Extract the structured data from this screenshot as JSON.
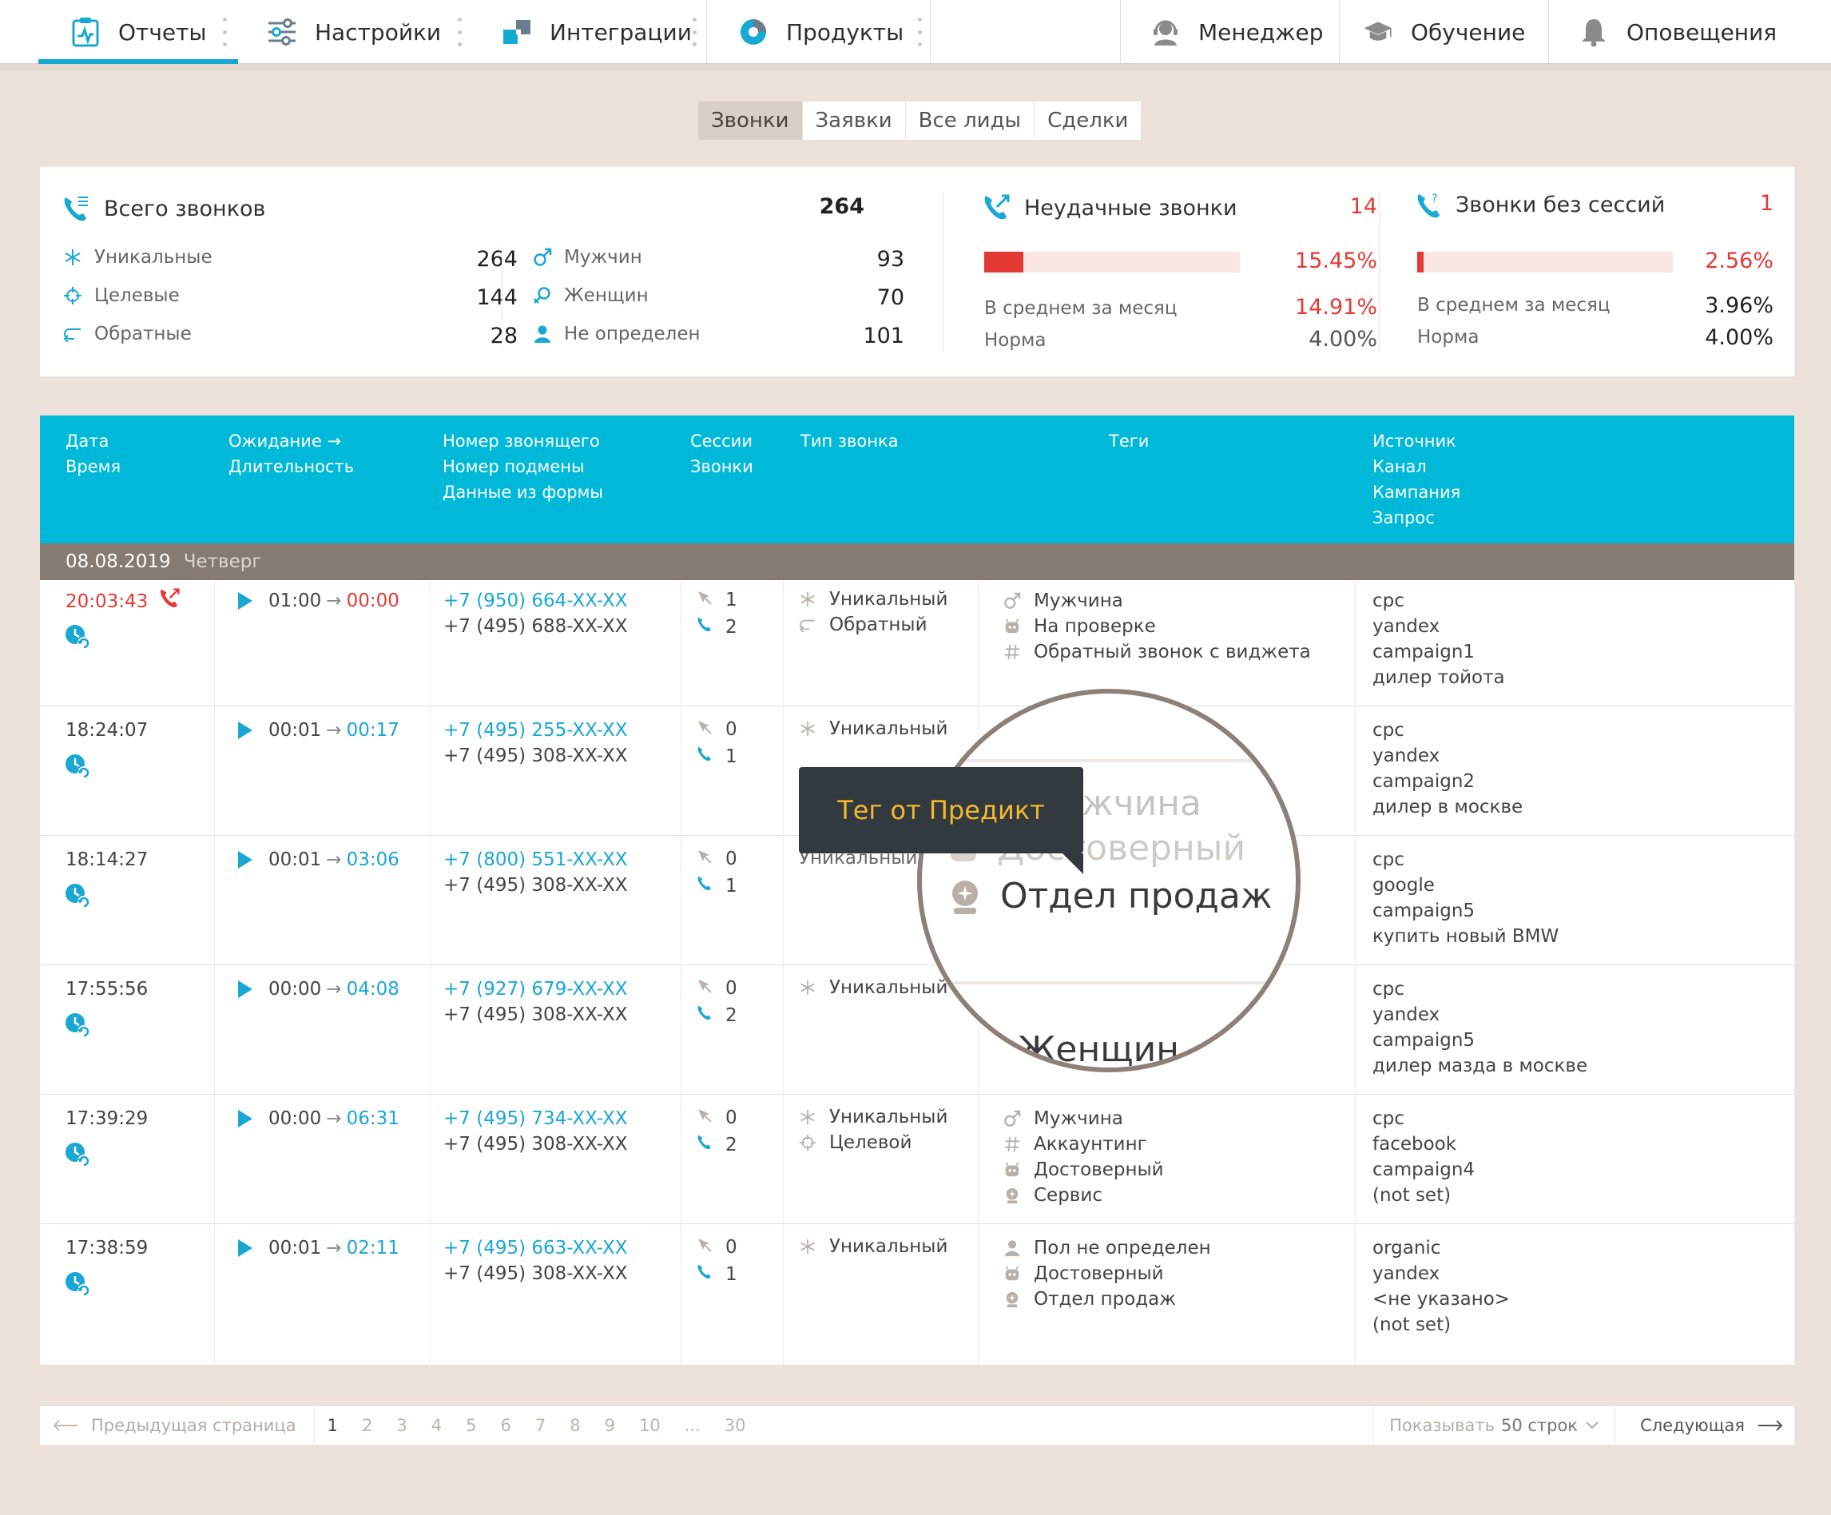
{
  "nav": {
    "items": [
      {
        "label": "Отчеты",
        "icon": "reports-icon"
      },
      {
        "label": "Настройки",
        "icon": "settings-sliders-icon"
      },
      {
        "label": "Интеграции",
        "icon": "integrations-icon"
      },
      {
        "label": "Продукты",
        "icon": "products-icon"
      }
    ],
    "right": [
      {
        "label": "Менеджер",
        "icon": "manager-headset-icon"
      },
      {
        "label": "Обучение",
        "icon": "education-cap-icon"
      },
      {
        "label": "Оповещения",
        "icon": "bell-icon"
      }
    ]
  },
  "tabs": [
    "Звонки",
    "Заявки",
    "Все лиды",
    "Сделки"
  ],
  "colors": {
    "accent": "#00b9d9",
    "link": "#1aa7d4",
    "danger": "#e53935",
    "band": "#857b73",
    "background": "#ece2db"
  },
  "stats": {
    "total": {
      "title": "Всего звонков",
      "value": "264"
    },
    "types": [
      {
        "label": "Уникальные",
        "value": "264"
      },
      {
        "label": "Целевые",
        "value": "144"
      },
      {
        "label": "Обратные",
        "value": "28"
      }
    ],
    "genders": [
      {
        "label": "Мужчин",
        "value": "93"
      },
      {
        "label": "Женщин",
        "value": "70"
      },
      {
        "label": "Не определен",
        "value": "101"
      }
    ],
    "failed": {
      "title": "Неудачные звонки",
      "value": "14",
      "percent": "15.45%",
      "progress": 0.1545,
      "avg_label": "В среднем за месяц",
      "avg": "14.91%",
      "norm_label": "Норма",
      "norm": "4.00%"
    },
    "nosession": {
      "title": "Звонки без сессий",
      "value": "1",
      "percent": "2.56%",
      "progress": 0.0256,
      "avg_label": "В среднем за месяц",
      "avg": "3.96%",
      "norm_label": "Норма",
      "norm": "4.00%"
    }
  },
  "table": {
    "headers": {
      "date": [
        "Дата",
        "Время"
      ],
      "wait": [
        "Ожидание →",
        "Длительность"
      ],
      "number": [
        "Номер звонящего",
        "Номер подмены",
        "Данные из формы"
      ],
      "sessions": [
        "Сессии",
        "Звонки"
      ],
      "type": [
        "Тип звонка"
      ],
      "tags": [
        "Теги"
      ],
      "source": [
        "Источник",
        "Канал",
        "Кампания",
        "Запрос"
      ]
    },
    "date_band": {
      "date": "08.08.2019",
      "weekday": "Четверг"
    },
    "rows": [
      {
        "time": "20:03:43",
        "failed": true,
        "wait": "01:00",
        "dur": "00:00",
        "caller": "+7 (950) 664-XX-XX",
        "sub": "+7 (495) 688-XX-XX",
        "sessions": "1",
        "calls": "2",
        "types": [
          {
            "icon": "asterisk-icon",
            "label": "Уникальный"
          },
          {
            "icon": "callback-icon",
            "label": "Обратный"
          }
        ],
        "tags": [
          {
            "icon": "male-icon",
            "label": "Мужчина"
          },
          {
            "icon": "robot-icon",
            "label": "На проверке"
          },
          {
            "icon": "hash-icon",
            "label": "Обратный звонок с виджета"
          }
        ],
        "source": [
          "cpc",
          "yandex",
          "campaign1",
          "дилер тойота"
        ]
      },
      {
        "time": "18:24:07",
        "failed": false,
        "wait": "00:01",
        "dur": "00:17",
        "caller": "+7 (495) 255-XX-XX",
        "sub": "+7 (495) 308-XX-XX",
        "sessions": "0",
        "calls": "1",
        "types": [
          {
            "icon": "asterisk-icon",
            "label": "Уникальный"
          }
        ],
        "tags": [],
        "source": [
          "cpc",
          "yandex",
          "campaign2",
          "дилер в москве"
        ]
      },
      {
        "time": "18:14:27",
        "failed": false,
        "wait": "00:01",
        "dur": "03:06",
        "caller": "+7 (800) 551-XX-XX",
        "sub": "+7 (495) 308-XX-XX",
        "sessions": "0",
        "calls": "1",
        "types": [],
        "tags": [],
        "source": [
          "cpc",
          "google",
          "campaign5",
          "купить новый BMW"
        ]
      },
      {
        "time": "17:55:56",
        "failed": false,
        "wait": "00:00",
        "dur": "04:08",
        "caller": "+7 (927) 679-XX-XX",
        "sub": "+7 (495) 308-XX-XX",
        "sessions": "0",
        "calls": "2",
        "types": [
          {
            "icon": "asterisk-icon",
            "label": "Уникальный"
          }
        ],
        "tags": [],
        "source": [
          "cpc",
          "yandex",
          "campaign5",
          "дилер мазда в москве"
        ]
      },
      {
        "time": "17:39:29",
        "failed": false,
        "wait": "00:00",
        "dur": "06:31",
        "caller": "+7 (495) 734-XX-XX",
        "sub": "+7 (495) 308-XX-XX",
        "sessions": "0",
        "calls": "2",
        "types": [
          {
            "icon": "asterisk-icon",
            "label": "Уникальный"
          },
          {
            "icon": "target-icon",
            "label": "Целевой"
          }
        ],
        "tags": [
          {
            "icon": "male-icon",
            "label": "Мужчина"
          },
          {
            "icon": "hash-icon",
            "label": "Аккаунтинг"
          },
          {
            "icon": "robot-icon",
            "label": "Достоверный"
          },
          {
            "icon": "predict-icon",
            "label": "Сервис"
          }
        ],
        "source": [
          "cpc",
          "facebook",
          "campaign4",
          "(not set)"
        ]
      },
      {
        "time": "17:38:59",
        "failed": false,
        "wait": "00:01",
        "dur": "02:11",
        "caller": "+7 (495) 663-XX-XX",
        "sub": "+7 (495) 308-XX-XX",
        "sessions": "0",
        "calls": "1",
        "types": [
          {
            "icon": "asterisk-icon",
            "label": "Уникальный"
          }
        ],
        "tags": [
          {
            "icon": "person-icon",
            "label": "Пол не определен"
          },
          {
            "icon": "robot-icon",
            "label": "Достоверный"
          },
          {
            "icon": "predict-icon",
            "label": "Отдел продаж"
          }
        ],
        "source": [
          "organic",
          "yandex",
          "<не указано>",
          "(not set)"
        ]
      }
    ]
  },
  "magnifier": {
    "partial_top": "жчина",
    "partial_mid": "Достоверный",
    "main": "Отдел продаж",
    "partial_bottom": "Женщин",
    "partial_left": "Уникальный"
  },
  "tooltip": "Тег от Предикт",
  "pagination": {
    "prev": "Предыдущая страница",
    "pages": [
      "1",
      "2",
      "3",
      "4",
      "5",
      "6",
      "7",
      "8",
      "9",
      "10",
      "...",
      "30"
    ],
    "current": "1",
    "show_label": "Показывать",
    "show_value": "50 строк",
    "next": "Следующая"
  }
}
